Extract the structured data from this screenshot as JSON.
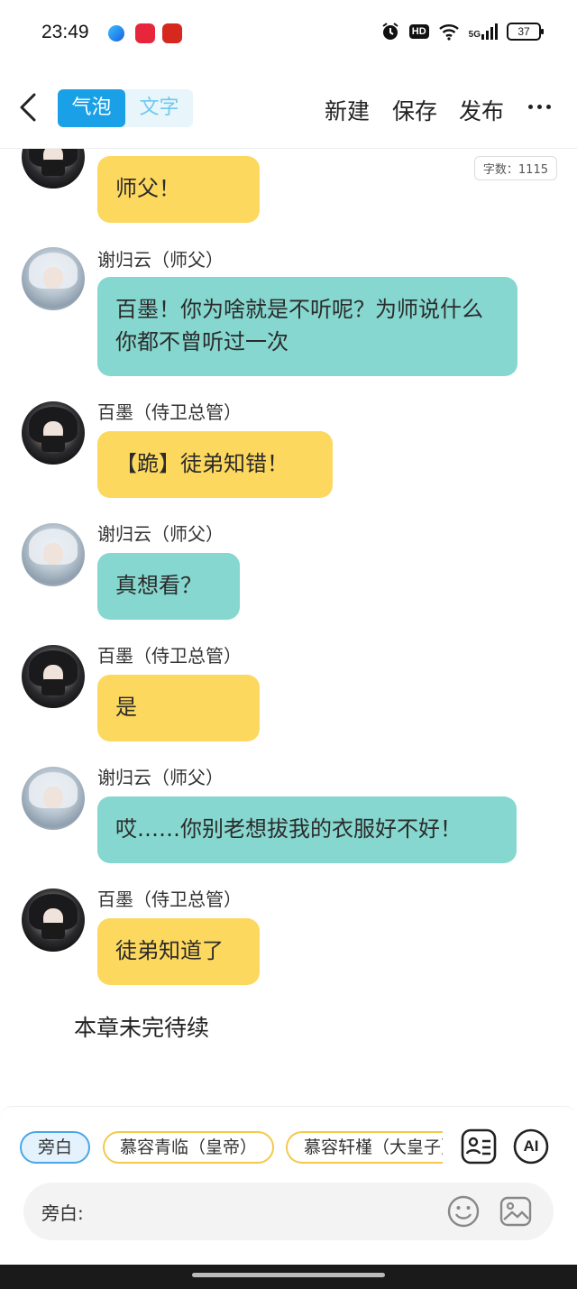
{
  "status": {
    "time": "23:49",
    "hd": "HD",
    "network": "5G",
    "battery": "37"
  },
  "header": {
    "tabs": [
      {
        "label": "气泡",
        "active": true
      },
      {
        "label": "文字",
        "active": false
      }
    ],
    "actions": {
      "new": "新建",
      "save": "保存",
      "publish": "发布"
    }
  },
  "word_count": "字数：1115",
  "messages": [
    {
      "speaker": "",
      "role": "baimo",
      "text": "师父！"
    },
    {
      "speaker": "谢归云（师父）",
      "role": "shifu",
      "text": "百墨！你为啥就是不听呢？为师说什么你都不曾听过一次"
    },
    {
      "speaker": "百墨（侍卫总管）",
      "role": "baimo",
      "text": "【跪】徒弟知错！"
    },
    {
      "speaker": "谢归云（师父）",
      "role": "shifu",
      "text": "真想看？"
    },
    {
      "speaker": "百墨（侍卫总管）",
      "role": "baimo",
      "text": "是"
    },
    {
      "speaker": "谢归云（师父）",
      "role": "shifu",
      "text": "哎……你别老想拔我的衣服好不好！"
    },
    {
      "speaker": "百墨（侍卫总管）",
      "role": "baimo",
      "text": "徒弟知道了"
    }
  ],
  "end_text": "本章未完待续",
  "characters": [
    "旁白",
    "慕容青临（皇帝）",
    "慕容轩槿（大皇子）"
  ],
  "tools": {
    "ai": "AI"
  },
  "input": {
    "label": "旁白:"
  },
  "colors": {
    "accent": "#1aa0e6",
    "bubble_yellow": "#fdd85e",
    "bubble_teal": "#86d7cf"
  }
}
